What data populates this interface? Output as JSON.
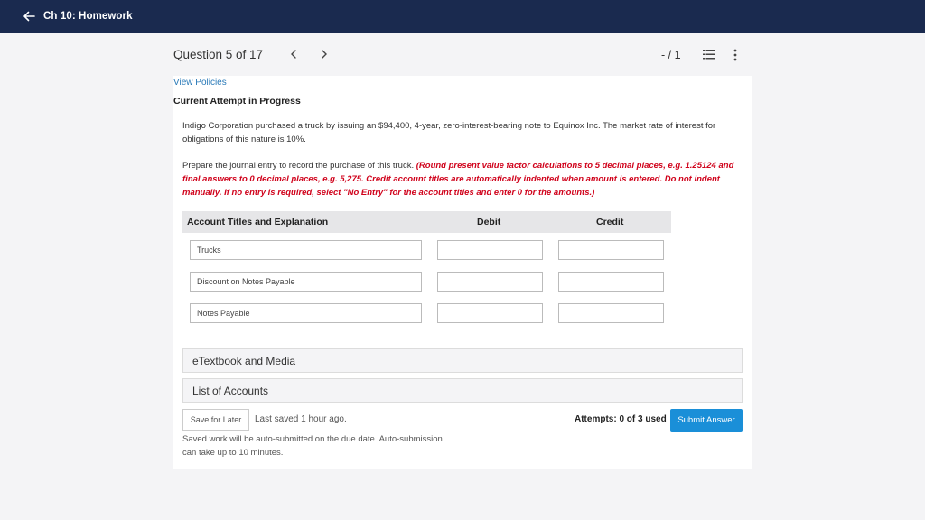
{
  "topbar": {
    "title": "Ch 10: Homework"
  },
  "header": {
    "question_label": "Question 5 of 17",
    "score": "- / 1"
  },
  "links": {
    "view_policies": "View Policies"
  },
  "attempt_heading": "Current Attempt in Progress",
  "problem_text": "Indigo Corporation purchased a truck by issuing an $94,400, 4-year, zero-interest-bearing note to Equinox Inc. The market rate of interest for obligations of this nature is 10%.",
  "instructions": {
    "lead": "Prepare the journal entry to record the purchase of this truck. ",
    "emphasis": "(Round present value factor calculations to 5 decimal places, e.g. 1.25124 and final answers to 0 decimal places, e.g. 5,275. Credit account titles are automatically indented when amount is entered. Do not indent manually. If no entry is required, select \"No Entry\" for the account titles and enter 0 for the amounts.)"
  },
  "journal": {
    "columns": [
      "Account Titles and Explanation",
      "Debit",
      "Credit"
    ],
    "rows": [
      {
        "account": "Trucks",
        "debit": "",
        "credit": ""
      },
      {
        "account": "Discount on Notes Payable",
        "debit": "",
        "credit": ""
      },
      {
        "account": "Notes Payable",
        "debit": "",
        "credit": ""
      }
    ]
  },
  "panels": [
    "eTextbook and Media",
    "List of Accounts"
  ],
  "footer": {
    "save_label": "Save for Later",
    "last_saved": "Last saved 1 hour ago.",
    "autosubmit": "Saved work will be auto-submitted on the due date. Auto-submission can take up to 10 minutes.",
    "attempts": "Attempts: 0 of 3 used",
    "submit_label": "Submit Answer"
  },
  "colors": {
    "topbar": "#1a2a4f",
    "link": "#2a7ab8",
    "alert": "#d0021b",
    "primary": "#1a8fd8"
  }
}
